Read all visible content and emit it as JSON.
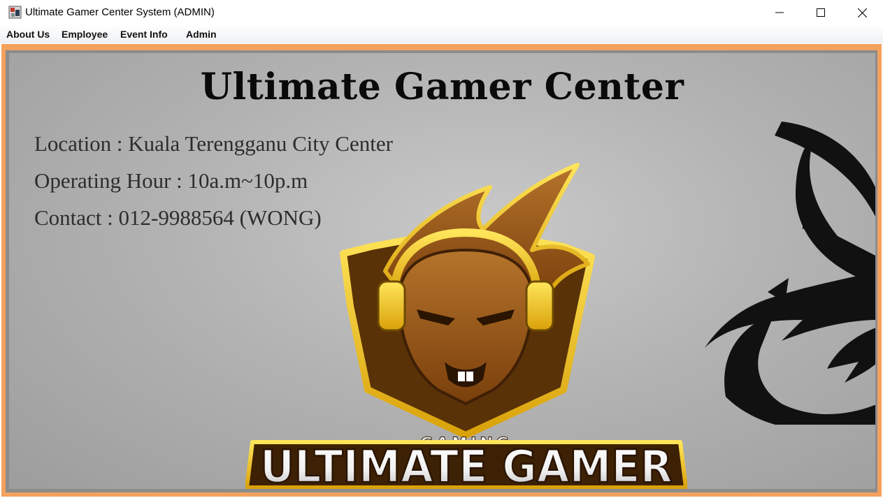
{
  "window": {
    "title": "Ultimate Gamer Center System (ADMIN)",
    "controls": [
      "minimize",
      "maximize",
      "close"
    ]
  },
  "menu": {
    "items": [
      {
        "label": "About Us"
      },
      {
        "label": "Employee"
      },
      {
        "label": "Event Info"
      },
      {
        "label": "Admin"
      }
    ]
  },
  "content": {
    "heading": "Ultimate Gamer Center",
    "location": "Location : Kuala Terengganu City Center",
    "hours": "Operating Hour : 10a.m~10p.m",
    "contact": "Contact : 012-9988564 (WONG)",
    "logo_top_text": "GAMING",
    "logo_bottom_text": "ULTIMATE GAMER"
  },
  "colors": {
    "frame_border": "#f4a15d",
    "logo_gold": "#f2c10e",
    "logo_brown": "#8a4d12"
  }
}
